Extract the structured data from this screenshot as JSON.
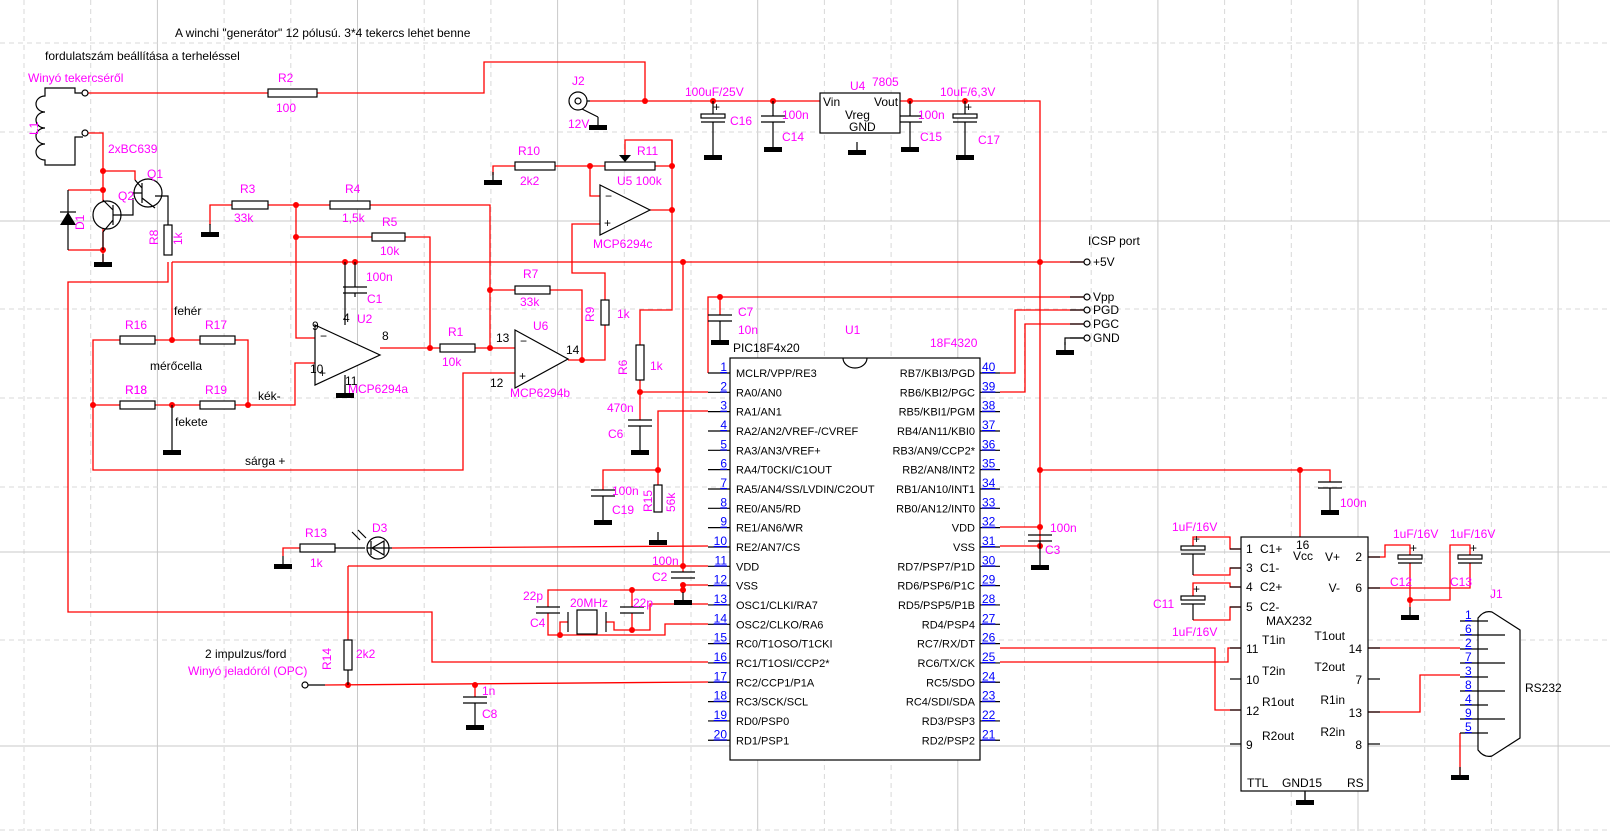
{
  "notes": {
    "title": "A winchi \"generátor\" 12 pólusú. 3*4 tekercs lehet benne",
    "subtitle": "fordulatszám beállítása a terheléssel",
    "coil_source": "Winyó tekercséről",
    "transistor_pair": "2xBC639",
    "bridge_white": "fehér",
    "bridge_cell": "mérőcella",
    "bridge_blue": "kék-",
    "bridge_black": "fekete",
    "bridge_yellow": "sárga +",
    "pulse": "2 impulzus/ford",
    "pulse_source": "Winyó jeladóról (OPC)",
    "icsp": "ICSP port"
  },
  "components": {
    "L1": {
      "ref": "L1"
    },
    "Q1": {
      "ref": "Q1"
    },
    "Q2": {
      "ref": "Q2"
    },
    "D1": {
      "ref": "D1"
    },
    "D3": {
      "ref": "D3"
    },
    "J2": {
      "ref": "J2",
      "value": "12V"
    },
    "R1": {
      "ref": "R1",
      "value": "10k"
    },
    "R2": {
      "ref": "R2",
      "value": "100"
    },
    "R3": {
      "ref": "R3",
      "value": "33k"
    },
    "R4": {
      "ref": "R4",
      "value": "1,5k"
    },
    "R5": {
      "ref": "R5",
      "value": "10k"
    },
    "R6": {
      "ref": "R6",
      "value": "1k"
    },
    "R7": {
      "ref": "R7",
      "value": "33k"
    },
    "R8": {
      "ref": "R8",
      "value": "1k"
    },
    "R9": {
      "ref": "R9",
      "value": "1k"
    },
    "R10": {
      "ref": "R10",
      "value": "2k2"
    },
    "R11": {
      "ref": "R11",
      "value": "U5 100k"
    },
    "R13": {
      "ref": "R13",
      "value": "1k"
    },
    "R14": {
      "ref": "R14",
      "value": "2k2"
    },
    "R15": {
      "ref": "R15",
      "value": "56k"
    },
    "R16": {
      "ref": "R16"
    },
    "R17": {
      "ref": "R17"
    },
    "R18": {
      "ref": "R18"
    },
    "R19": {
      "ref": "R19"
    },
    "C1": {
      "ref": "C1",
      "value": "100n"
    },
    "C2": {
      "ref": "C2",
      "value": "100n"
    },
    "C3": {
      "ref": "C3",
      "value": "100n"
    },
    "C4": {
      "ref": "C4",
      "value": "22p"
    },
    "C_osc2": {
      "value": "22p"
    },
    "C6": {
      "ref": "C6",
      "value": "470n"
    },
    "C7": {
      "ref": "C7",
      "value": "10n"
    },
    "C8": {
      "ref": "C8",
      "value": "1n"
    },
    "C11": {
      "ref": "C11",
      "value": "1uF/16V"
    },
    "C_c1": {
      "value": "1uF/16V"
    },
    "C12": {
      "ref": "C12",
      "value": "1uF/16V"
    },
    "C13": {
      "ref": "C13",
      "value": "1uF/16V"
    },
    "C14": {
      "ref": "C14",
      "value": "100n"
    },
    "C15": {
      "ref": "C15",
      "value": "100n"
    },
    "C16": {
      "ref": "C16",
      "value": "100uF/25V"
    },
    "C17": {
      "ref": "C17",
      "value": "10uF/6,3V"
    },
    "C19": {
      "ref": "C19",
      "value": "100n"
    },
    "C_vcc": {
      "value": "100n"
    },
    "X1": {
      "value": "20MHz"
    },
    "U2": {
      "ref": "U2",
      "part": "MCP6294a",
      "inv": "9",
      "noninv": "10",
      "out": "8",
      "vp": "4",
      "vn": "11"
    },
    "U6": {
      "ref": "U6",
      "part": "MCP6294b",
      "inv": "13",
      "noninv": "12",
      "out": "14"
    },
    "U5": {
      "part": "MCP6294c"
    },
    "U4": {
      "ref": "U4",
      "part": "7805",
      "name": "Vreg",
      "vin": "Vin",
      "vout": "Vout",
      "gnd": "GND"
    }
  },
  "u1": {
    "ref": "U1",
    "part": "18F4320",
    "family": "PIC18F4x20",
    "left_pins": [
      {
        "num": "1",
        "name": "MCLR/VPP/RE3"
      },
      {
        "num": "2",
        "name": "RA0/AN0"
      },
      {
        "num": "3",
        "name": "RA1/AN1"
      },
      {
        "num": "4",
        "name": "RA2/AN2/VREF-/CVREF"
      },
      {
        "num": "5",
        "name": "RA3/AN3/VREF+"
      },
      {
        "num": "6",
        "name": "RA4/T0CKI/C1OUT"
      },
      {
        "num": "7",
        "name": "RA5/AN4/SS/LVDIN/C2OUT"
      },
      {
        "num": "8",
        "name": "RE0/AN5/RD"
      },
      {
        "num": "9",
        "name": "RE1/AN6/WR"
      },
      {
        "num": "10",
        "name": "RE2/AN7/CS"
      },
      {
        "num": "11",
        "name": "VDD"
      },
      {
        "num": "12",
        "name": "VSS"
      },
      {
        "num": "13",
        "name": "OSC1/CLKI/RA7"
      },
      {
        "num": "14",
        "name": "OSC2/CLKO/RA6"
      },
      {
        "num": "15",
        "name": "RC0/T1OSO/T1CKI"
      },
      {
        "num": "16",
        "name": "RC1/T1OSI/CCP2*"
      },
      {
        "num": "17",
        "name": "RC2/CCP1/P1A"
      },
      {
        "num": "18",
        "name": "RC3/SCK/SCL"
      },
      {
        "num": "19",
        "name": "RD0/PSP0"
      },
      {
        "num": "20",
        "name": "RD1/PSP1"
      }
    ],
    "right_pins": [
      {
        "num": "40",
        "name": "RB7/KBI3/PGD"
      },
      {
        "num": "39",
        "name": "RB6/KBI2/PGC"
      },
      {
        "num": "38",
        "name": "RB5/KBI1/PGM"
      },
      {
        "num": "37",
        "name": "RB4/AN11/KBI0"
      },
      {
        "num": "36",
        "name": "RB3/AN9/CCP2*"
      },
      {
        "num": "35",
        "name": "RB2/AN8/INT2"
      },
      {
        "num": "34",
        "name": "RB1/AN10/INT1"
      },
      {
        "num": "33",
        "name": "RB0/AN12/INT0"
      },
      {
        "num": "32",
        "name": "VDD"
      },
      {
        "num": "31",
        "name": "VSS"
      },
      {
        "num": "30",
        "name": "RD7/PSP7/P1D"
      },
      {
        "num": "29",
        "name": "RD6/PSP6/P1C"
      },
      {
        "num": "28",
        "name": "RD5/PSP5/P1B"
      },
      {
        "num": "27",
        "name": "RD4/PSP4"
      },
      {
        "num": "26",
        "name": "RC7/RX/DT"
      },
      {
        "num": "25",
        "name": "RC6/TX/CK"
      },
      {
        "num": "24",
        "name": "RC5/SDO"
      },
      {
        "num": "23",
        "name": "RC4/SDI/SDA"
      },
      {
        "num": "22",
        "name": "RD3/PSP3"
      },
      {
        "num": "21",
        "name": "RD2/PSP2"
      }
    ]
  },
  "max232": {
    "part": "MAX232",
    "vcc": "Vcc",
    "vcc_pin": "16",
    "ttl": "TTL",
    "gnd": "GND15",
    "rs": "RS",
    "left_pins": [
      {
        "num": "1",
        "name": "C1+"
      },
      {
        "num": "3",
        "name": "C1-"
      },
      {
        "num": "4",
        "name": "C2+"
      },
      {
        "num": "5",
        "name": "C2-"
      },
      {
        "num": "11",
        "name": "T1in"
      },
      {
        "num": "10",
        "name": "T2in"
      },
      {
        "num": "12",
        "name": "R1out"
      },
      {
        "num": "9",
        "name": "R2out"
      }
    ],
    "right_pins": [
      {
        "num": "2",
        "name": "V+"
      },
      {
        "num": "6",
        "name": "V-"
      },
      {
        "num": "14",
        "name": "T1out"
      },
      {
        "num": "7",
        "name": "T2out"
      },
      {
        "num": "13",
        "name": "R1in"
      },
      {
        "num": "8",
        "name": "R2in"
      }
    ]
  },
  "j1": {
    "ref": "J1",
    "name": "RS232",
    "pins": [
      "1",
      "6",
      "2",
      "7",
      "3",
      "8",
      "4",
      "9",
      "5"
    ]
  },
  "icsp": {
    "pins": [
      "+5V",
      "Vpp",
      "PGD",
      "PGC",
      "GND"
    ]
  },
  "colors": {
    "wire": "#ff0000",
    "label": "#ff00ff",
    "pin_number": "#0000ff",
    "grid": "#c8c8c8"
  }
}
